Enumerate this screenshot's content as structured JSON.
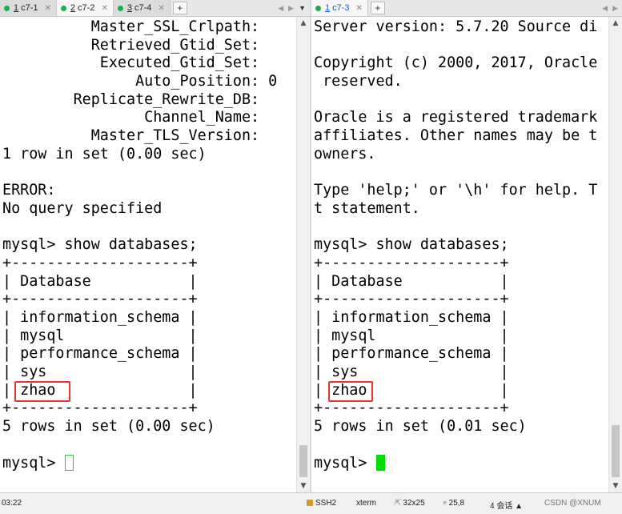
{
  "left": {
    "tabs": [
      {
        "num": "1",
        "name": "c7-1",
        "active": false
      },
      {
        "num": "2",
        "name": "c7-2",
        "active": true
      },
      {
        "num": "3",
        "name": "c7-4",
        "active": false
      }
    ],
    "lines": [
      "          Master_SSL_Crlpath:",
      "          Retrieved_Gtid_Set:",
      "           Executed_Gtid_Set:",
      "               Auto_Position: 0",
      "        Replicate_Rewrite_DB:",
      "                Channel_Name:",
      "          Master_TLS_Version:",
      "1 row in set (0.00 sec)",
      "",
      "ERROR:",
      "No query specified",
      "",
      "mysql> show databases;",
      "+--------------------+",
      "| Database           |",
      "+--------------------+",
      "| information_schema |",
      "| mysql              |",
      "| performance_schema |",
      "| sys                |",
      "| zhao               |",
      "+--------------------+",
      "5 rows in set (0.00 sec)",
      "",
      "mysql> "
    ]
  },
  "right": {
    "tabs": [
      {
        "num": "1",
        "name": "c7-3",
        "active": true
      }
    ],
    "lines": [
      "Server version: 5.7.20 Source di",
      "",
      "Copyright (c) 2000, 2017, Oracle",
      " reserved.",
      "",
      "Oracle is a registered trademark",
      "affiliates. Other names may be t",
      "owners.",
      "",
      "Type 'help;' or '\\h' for help. T",
      "t statement.",
      "",
      "mysql> show databases;",
      "+--------------------+",
      "| Database           |",
      "+--------------------+",
      "| information_schema |",
      "| mysql              |",
      "| performance_schema |",
      "| sys                |",
      "| zhao               |",
      "+--------------------+",
      "5 rows in set (0.01 sec)",
      "",
      "mysql> "
    ]
  },
  "status": {
    "time": "03:22",
    "protocol": "SSH2",
    "term": "xterm",
    "size": "32x25",
    "pos": "25,8",
    "sessions": "4 会话",
    "watermark": "CSDN @XNUM"
  },
  "colors": {
    "highlight": "#e8332a",
    "cursor": "#00dd00",
    "tab_dot": "#18b04a"
  }
}
